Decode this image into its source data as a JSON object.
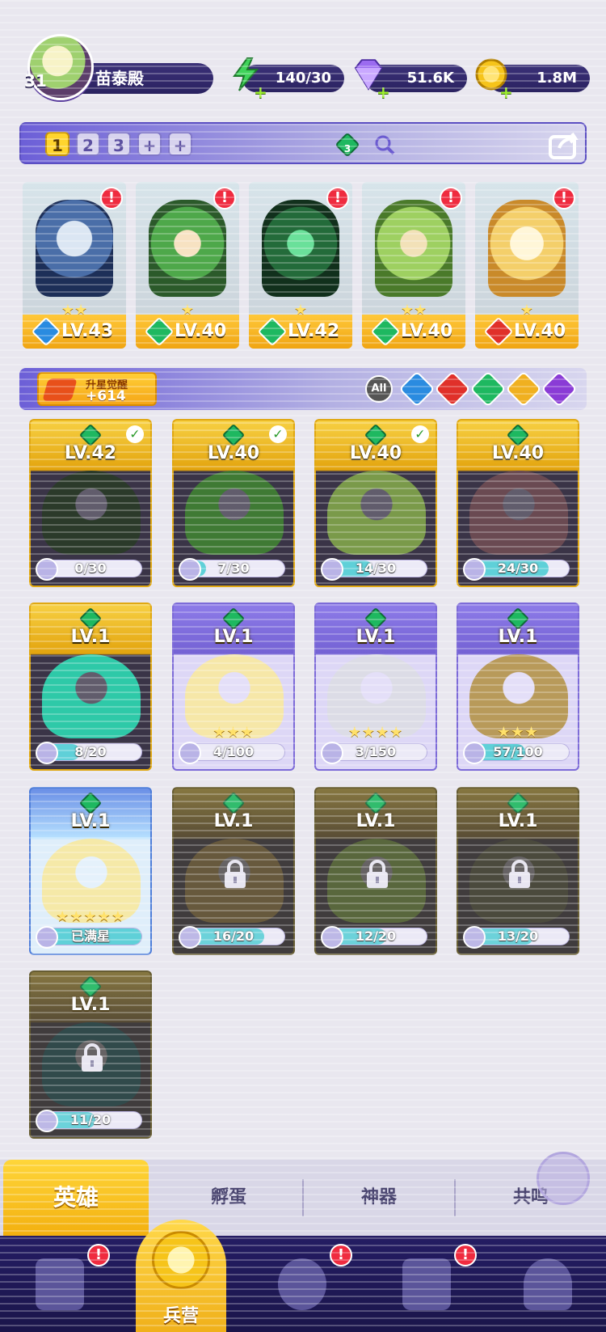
{
  "player": {
    "level": "31",
    "name": "苗泰殿"
  },
  "resources": [
    {
      "name": "energy",
      "icon": "lightning-icon",
      "value": "140/30",
      "color": "#3fd35a"
    },
    {
      "name": "gems",
      "icon": "diamond-icon",
      "value": "51.6K",
      "color": "#9b6bf0"
    },
    {
      "name": "gold",
      "icon": "coin-icon",
      "value": "1.8M",
      "color": "#f6c41a"
    }
  ],
  "team": {
    "tabs": [
      "1",
      "2",
      "3",
      "+",
      "+"
    ],
    "active_tab": "1",
    "nature_count": "3",
    "members": [
      {
        "level": "LV.43",
        "element": "water",
        "element_color": "#2a8be0",
        "stars": "★★",
        "alert": "!"
      },
      {
        "level": "LV.40",
        "element": "nature",
        "element_color": "#1eb860",
        "stars": "★",
        "alert": "!"
      },
      {
        "level": "LV.42",
        "element": "nature",
        "element_color": "#1eb860",
        "stars": "★",
        "alert": "!"
      },
      {
        "level": "LV.40",
        "element": "nature",
        "element_color": "#1eb860",
        "stars": "★★",
        "alert": "!"
      },
      {
        "level": "LV.40",
        "element": "fire",
        "element_color": "#e0302a",
        "stars": "★",
        "alert": "!"
      }
    ]
  },
  "awaken": {
    "label": "升星觉醒",
    "value": "+614"
  },
  "filters": [
    {
      "label": "All",
      "color": "#555555"
    },
    {
      "name": "water",
      "color": "#2a8be0"
    },
    {
      "name": "fire",
      "color": "#e0302a"
    },
    {
      "name": "nature",
      "color": "#1eb860"
    },
    {
      "name": "light",
      "color": "#f0b020"
    },
    {
      "name": "dark",
      "color": "#8a3bd6"
    }
  ],
  "heroes": [
    {
      "level": "LV.42",
      "progress": "0/30",
      "fraction": 0.0,
      "stars": "",
      "style": "gold",
      "checked": true,
      "locked": false
    },
    {
      "level": "LV.40",
      "progress": "7/30",
      "fraction": 0.23,
      "stars": "",
      "style": "gold",
      "checked": true,
      "locked": false
    },
    {
      "level": "LV.40",
      "progress": "14/30",
      "fraction": 0.47,
      "stars": "",
      "style": "gold",
      "checked": true,
      "locked": false
    },
    {
      "level": "LV.40",
      "progress": "24/30",
      "fraction": 0.8,
      "stars": "",
      "style": "gold",
      "checked": false,
      "locked": false
    },
    {
      "level": "LV.1",
      "progress": "8/20",
      "fraction": 0.4,
      "stars": "",
      "style": "gold",
      "checked": false,
      "locked": false
    },
    {
      "level": "LV.1",
      "progress": "4/100",
      "fraction": 0.04,
      "stars": "★★★",
      "style": "purple",
      "checked": false,
      "locked": false
    },
    {
      "level": "LV.1",
      "progress": "3/150",
      "fraction": 0.02,
      "stars": "★★★★",
      "style": "purple",
      "checked": false,
      "locked": false
    },
    {
      "level": "LV.1",
      "progress": "57/100",
      "fraction": 0.57,
      "stars": "★★★",
      "style": "purple",
      "checked": false,
      "locked": false
    },
    {
      "level": "LV.1",
      "progress": "已满星",
      "fraction": 1.0,
      "stars": "★★★★★",
      "style": "blue",
      "checked": false,
      "locked": false
    },
    {
      "level": "LV.1",
      "progress": "16/20",
      "fraction": 0.8,
      "stars": "",
      "style": "locked",
      "checked": false,
      "locked": true
    },
    {
      "level": "LV.1",
      "progress": "12/20",
      "fraction": 0.6,
      "stars": "",
      "style": "locked",
      "checked": false,
      "locked": true
    },
    {
      "level": "LV.1",
      "progress": "13/20",
      "fraction": 0.65,
      "stars": "",
      "style": "locked",
      "checked": false,
      "locked": true
    },
    {
      "level": "LV.1",
      "progress": "11/20",
      "fraction": 0.55,
      "stars": "",
      "style": "locked",
      "checked": false,
      "locked": true
    }
  ],
  "sub_tabs": [
    "英雄",
    "孵蛋",
    "神器",
    "共鸣"
  ],
  "nav": {
    "active_label": "兵营",
    "items": [
      {
        "icon": "cards-icon",
        "alert": "!"
      },
      {
        "icon": "barracks-icon",
        "label": "兵营"
      },
      {
        "icon": "book-icon",
        "alert": "!"
      },
      {
        "icon": "castle-icon",
        "alert": "!"
      },
      {
        "icon": "guild-icon"
      }
    ]
  }
}
